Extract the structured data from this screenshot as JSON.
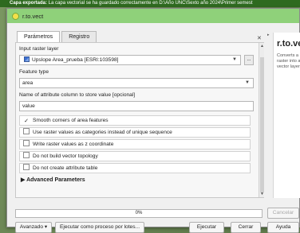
{
  "message_bar": {
    "bold": "Capa exportada:",
    "text": " La capa vectorial se ha guardado correctamente en D:\\Año UNC\\Sexto año 2024\\Primer semest"
  },
  "window": {
    "title": "r.to.vect"
  },
  "tabs": [
    "Parámetros",
    "Registro"
  ],
  "params": {
    "input_raster_label": "Input raster layer",
    "input_raster_value": "Upslope Area_prueba [ESRI:103598]",
    "feature_type_label": "Feature type",
    "feature_type_value": "area",
    "attribute_label": "Name of attribute column to store value [opcional]",
    "attribute_value": "value",
    "options": [
      {
        "label": "Smooth corners of area features",
        "checked": true
      },
      {
        "label": "Use raster values as categories instead of unique sequence",
        "checked": false
      },
      {
        "label": "Write raster values as z coordinate",
        "checked": false
      },
      {
        "label": "Do not build vector topology",
        "checked": false
      },
      {
        "label": "Do not create attribute table",
        "checked": false
      }
    ],
    "advanced_label": "Advanced Parameters",
    "browse_label": "..."
  },
  "help": {
    "title": "r.to.vect",
    "description": "Converts a raster into a vector layer."
  },
  "progress": {
    "value": 0,
    "label": "0%"
  },
  "buttons": {
    "cancel": "Cancelar",
    "advanced": "Avanzado",
    "batch": "Ejecutar como proceso por lotes...",
    "run": "Ejecutar",
    "close": "Cerrar",
    "help": "Ayuda"
  },
  "colors": {
    "title_bar": "#8fd17a",
    "message_bar": "#2e6a1f"
  }
}
